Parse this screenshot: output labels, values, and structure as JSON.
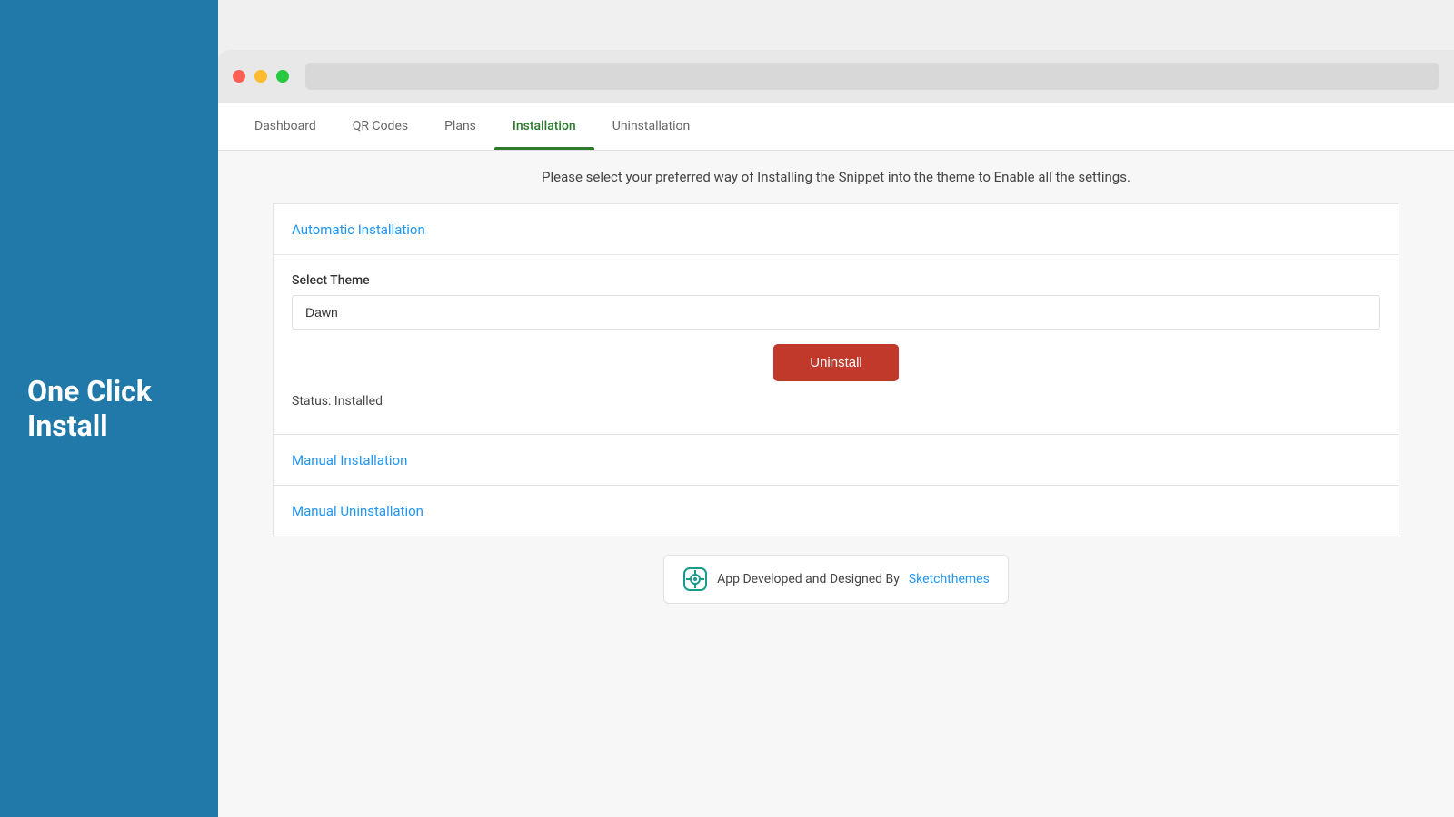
{
  "sidebar": {
    "title_line1": "One Click",
    "title_line2": "Install"
  },
  "browser": {
    "address_bar_placeholder": ""
  },
  "nav": {
    "tabs": [
      {
        "id": "dashboard",
        "label": "Dashboard",
        "active": false
      },
      {
        "id": "qr-codes",
        "label": "QR Codes",
        "active": false
      },
      {
        "id": "plans",
        "label": "Plans",
        "active": false
      },
      {
        "id": "installation",
        "label": "Installation",
        "active": true
      },
      {
        "id": "uninstallation",
        "label": "Uninstallation",
        "active": false
      }
    ]
  },
  "main": {
    "instruction": "Please select your preferred way of Installing the Snippet into the theme to Enable all the settings.",
    "automatic_section": {
      "label": "Automatic Installation"
    },
    "form": {
      "select_theme_label": "Select Theme",
      "theme_value": "Dawn",
      "uninstall_button": "Uninstall",
      "status_text": "Status: Installed"
    },
    "manual_installation_section": {
      "label": "Manual Installation"
    },
    "manual_uninstallation_section": {
      "label": "Manual Uninstallation"
    }
  },
  "footer": {
    "badge_text": "App Developed and Designed By",
    "badge_link_text": "Sketchthemes"
  }
}
